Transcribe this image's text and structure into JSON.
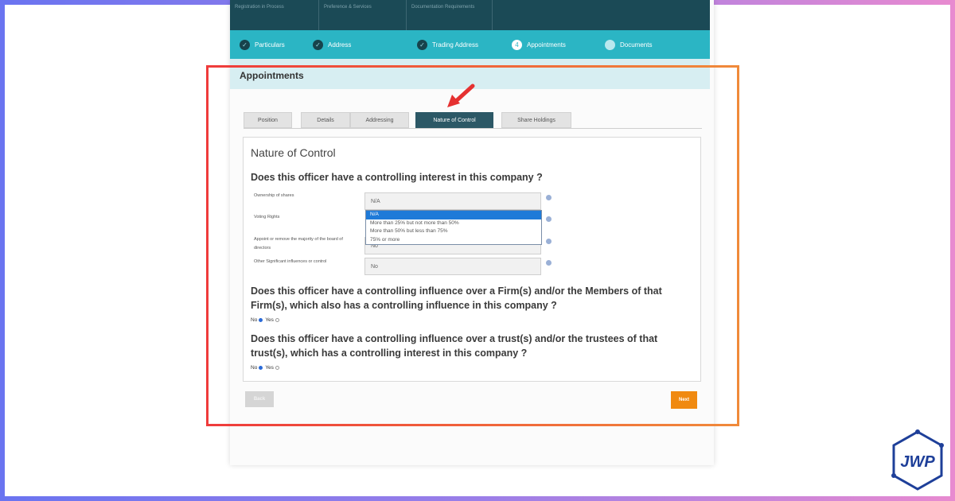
{
  "header": {
    "cols": [
      "Registration in Process",
      "Preference & Services",
      "Documentation Requirements"
    ]
  },
  "stepper": [
    {
      "label": "Particulars",
      "state": "done",
      "marker": "✓"
    },
    {
      "label": "Address",
      "state": "done",
      "marker": "✓"
    },
    {
      "label": "Trading Address",
      "state": "done",
      "marker": "✓"
    },
    {
      "label": "Appointments",
      "state": "active",
      "marker": "4"
    },
    {
      "label": "Documents",
      "state": "pending",
      "marker": ""
    }
  ],
  "section": {
    "title": "Appointments"
  },
  "tabs": [
    "Position",
    "Details",
    "Addressing",
    "Nature of Control",
    "Share Holdings"
  ],
  "panel": {
    "title": "Nature of Control",
    "q1": "Does this officer have a controlling interest in this company ?",
    "rows": [
      {
        "label": "Ownership of shares",
        "value": "N/A"
      },
      {
        "label": "Voting Rights",
        "value": ""
      },
      {
        "label": "Appoint or remove the majority of the board of directors",
        "value": "No"
      },
      {
        "label": "Other Significant influences or control",
        "value": "No"
      }
    ],
    "dropdown_options": [
      "N/A",
      "More than 25% but not more than 50%",
      "More than 50% but less than 75%",
      "75% or more"
    ],
    "q2": "Does this officer have a controlling influence over a Firm(s) and/or the Members of that Firm(s), which also has a controlling influence in this company ?",
    "q3": "Does this officer have a controlling influence over a trust(s) and/or the trustees of that trust(s), which has a controlling interest in this company ?",
    "radio_no": "No",
    "radio_yes": "Yes"
  },
  "buttons": {
    "back": "Back",
    "next": "Next"
  },
  "colors": {
    "accent_teal": "#2bb5c4",
    "dark_header": "#1b4a56",
    "active_tab": "#2c5866",
    "next_orange": "#f08a10",
    "highlight_red": "#ef3b3b",
    "highlight_orange": "#f08a3a"
  },
  "logo": {
    "text": "JWP"
  },
  "icons": {
    "arrow": "red-pointer-arrow",
    "info": "info-dot-icon",
    "check": "check-icon"
  }
}
